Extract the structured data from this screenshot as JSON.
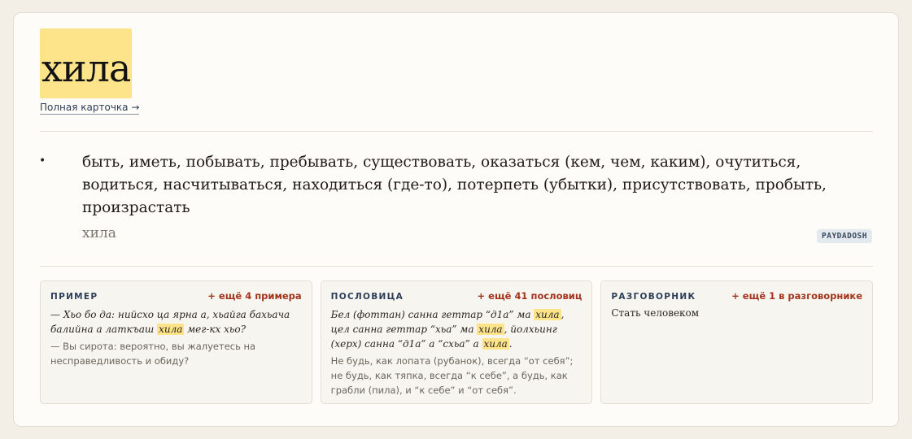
{
  "headword": "хила",
  "full_card_link": "Полная карточка →",
  "definition": {
    "bullet": "•",
    "text": "быть, иметь, побывать, пребывать, существовать, оказаться (кем, чем, каким), очутиться, водиться, насчитываться, находиться (где-то), потерпеть (убытки), присутствовать, пробыть, произрастать",
    "translit": "хила",
    "source": "PAYDADOSH"
  },
  "panels": {
    "example": {
      "title": "ПРИМЕР",
      "more": "+ ещё 4 примера",
      "source_before": "— Хьо бо да: нийсхо ца ярна а, хьайга бахьача балийна а латкъаш ",
      "source_mark": "хила",
      "source_after": " мег-кх хьо?",
      "translation": "— Вы сирота: вероятно, вы жалуетесь на несправедливость и обиду?"
    },
    "proverb": {
      "title": "ПОСЛОВИЦА",
      "more": "+ ещё 41 пословиц",
      "part1": "Бел (фоттан) санна геттар “д1а” ма ",
      "mark1": "хила",
      "part2": ", цел санна геттар “хьа” ма ",
      "mark2": "хила",
      "part3": ", йолхьинг (херх) санна “д1а” а “схьа” а ",
      "mark3": "хила",
      "part4": ".",
      "translation": "Не будь, как лопата (рубанок), всегда “от себя”; не будь, как тяпка, всегда “к себе”, а будь, как грабли (пила), и “к себе” и “от себя”."
    },
    "phrasebook": {
      "title": "РАЗГОВОРНИК",
      "more": "+ ещё 1 в разговорнике",
      "phrase": "Стать человеком"
    }
  }
}
